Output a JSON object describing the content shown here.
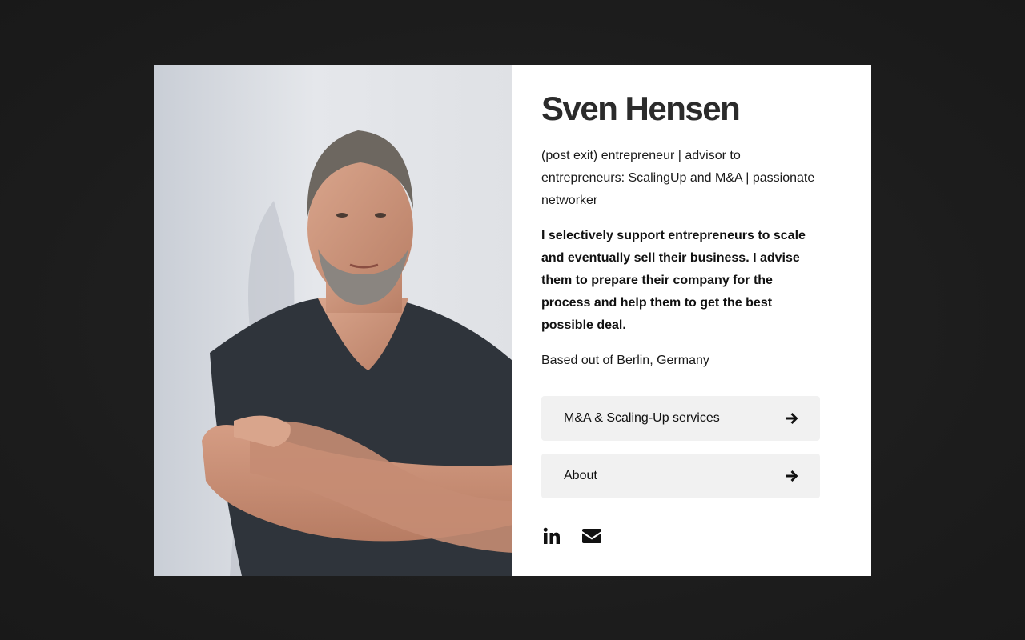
{
  "profile": {
    "name": "Sven Hensen",
    "tagline": "(post exit) entrepreneur | advisor to entrepreneurs: ScalingUp and M&A | passionate networker",
    "bio": "I selectively support entrepreneurs to scale and eventually sell their business. I advise them to prepare their company for the process and help them to get the best possible deal.",
    "location": "Based out of Berlin, Germany"
  },
  "links": [
    {
      "label": "M&A & Scaling-Up services",
      "icon": "arrow-right-icon"
    },
    {
      "label": "About",
      "icon": "arrow-right-icon"
    }
  ],
  "social": [
    {
      "icon": "linkedin-icon"
    },
    {
      "icon": "email-icon"
    }
  ],
  "colors": {
    "page_background": "#1f1f1f",
    "card_background": "#ffffff",
    "button_background": "#f1f1f1",
    "name_color": "#2b2b2b"
  }
}
